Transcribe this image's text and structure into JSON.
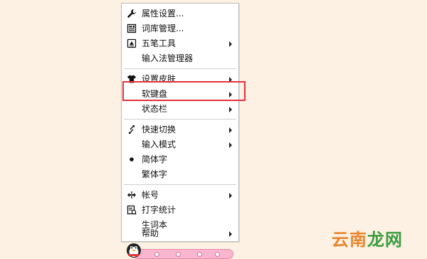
{
  "menu": {
    "items": [
      {
        "label": "属性设置...",
        "icon": "wrench-icon",
        "submenu": false
      },
      {
        "label": "词库管理...",
        "icon": "dictionary-icon",
        "submenu": false
      },
      {
        "label": "五笔工具",
        "icon": "tool-window-icon",
        "submenu": true
      },
      {
        "label": "输入法管理器",
        "icon": "",
        "submenu": false
      },
      {
        "label": "设置皮肤",
        "icon": "shirt-icon",
        "submenu": true
      },
      {
        "label": "软键盘",
        "icon": "",
        "submenu": true
      },
      {
        "label": "状态栏",
        "icon": "",
        "submenu": true
      },
      {
        "label": "快速切换",
        "icon": "switch-icon",
        "submenu": true
      },
      {
        "label": "输入模式",
        "icon": "",
        "submenu": true
      },
      {
        "label": "简体字",
        "icon": "bullet-icon",
        "submenu": false
      },
      {
        "label": "繁体字",
        "icon": "",
        "submenu": false
      },
      {
        "label": "帐号",
        "icon": "account-icon",
        "submenu": true
      },
      {
        "label": "打字统计",
        "icon": "statistics-icon",
        "submenu": false
      },
      {
        "label": "生词本",
        "icon": "",
        "submenu": false
      },
      {
        "label": "帮助",
        "icon": "",
        "submenu": true
      }
    ],
    "highlighted_item": "软键盘",
    "selected_item": "简体字"
  },
  "watermark": {
    "part1": "云南",
    "part2": "龙网"
  },
  "colors": {
    "background": "#fdf1e4",
    "highlight_box": "#e2313a",
    "status_bar": "#f9b7cf",
    "watermark_orange": "#e8862e",
    "watermark_green": "#3d9c3f"
  }
}
